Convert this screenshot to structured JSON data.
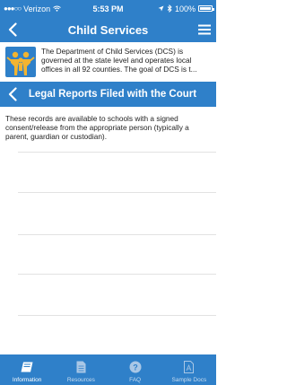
{
  "status": {
    "carrier": "Verizon",
    "time": "5:53 PM",
    "battery": "100%"
  },
  "nav": {
    "title": "Child Services"
  },
  "info": {
    "text": "The Department of Child Services (DCS) is governed at the state level and operates local offices in all 92 counties. The goal of DCS is t..."
  },
  "section": {
    "title": "Legal Reports Filed with the Court"
  },
  "content": {
    "description": "These records are available to schools with a signed consent/release from the appropriate person (typically a parent, guardian or custodian)."
  },
  "tabs": [
    {
      "label": "Information",
      "icon": "book-icon",
      "active": true
    },
    {
      "label": "Resources",
      "icon": "document-icon",
      "active": false
    },
    {
      "label": "FAQ",
      "icon": "question-icon",
      "active": false
    },
    {
      "label": "Sample Docs",
      "icon": "pdf-icon",
      "active": false
    }
  ],
  "colors": {
    "primary": "#2f80c9",
    "logo_background": "#2f80c9",
    "logo_figure": "#f2b431"
  }
}
